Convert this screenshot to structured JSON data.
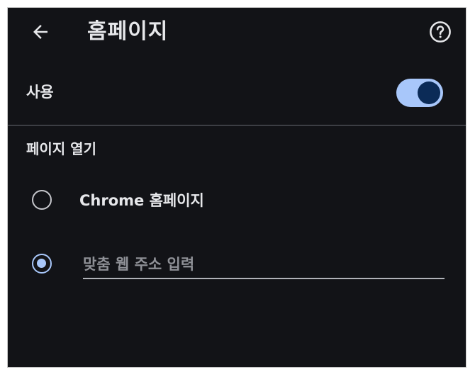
{
  "header": {
    "title": "홈페이지",
    "back_icon": "arrow-left-icon",
    "help_icon": "help-circle-icon"
  },
  "enable_row": {
    "label": "사용",
    "toggle_on": true
  },
  "open_section": {
    "header": "페이지 열기",
    "options": [
      {
        "label": "Chrome 홈페이지",
        "selected": false
      },
      {
        "placeholder": "맞춤 웹 주소 입력",
        "value": "",
        "selected": true
      }
    ]
  },
  "colors": {
    "background": "#121317",
    "text": "#e6e7ea",
    "accent": "#a8c7fa",
    "toggle_knob": "#0b2b57",
    "divider": "#3c3e44"
  }
}
